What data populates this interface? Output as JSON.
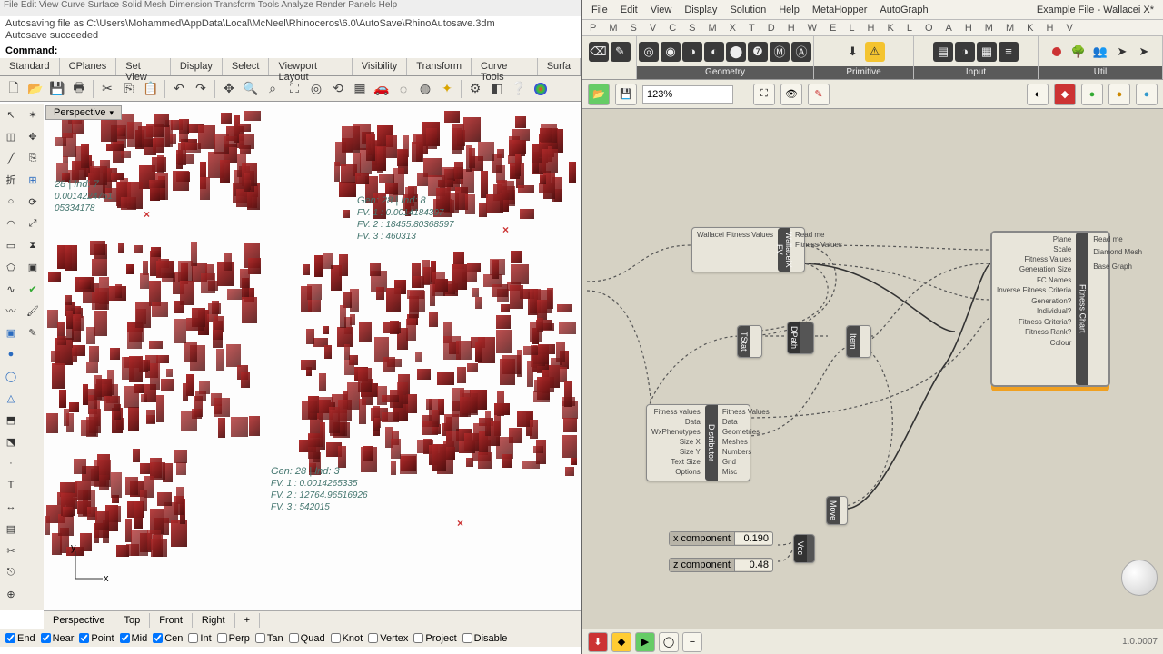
{
  "rhino": {
    "menubar": "File  Edit  View  Curve  Surface  Solid  Mesh  Dimension  Transform  Tools  Analyze  Render  Panels  Help",
    "autosave_line": "Autosaving file as C:\\Users\\Mohammed\\AppData\\Local\\McNeel\\Rhinoceros\\6.0\\AutoSave\\RhinoAutosave.3dm",
    "autosave_done": "Autosave succeeded",
    "command_label": "Command:",
    "tabs": [
      "Standard",
      "CPlanes",
      "Set View",
      "Display",
      "Select",
      "Viewport Layout",
      "Visibility",
      "Transform",
      "Curve Tools",
      "Surfa"
    ],
    "viewport_label": "Perspective",
    "view_tabs": [
      "Perspective",
      "Top",
      "Front",
      "Right",
      "+"
    ],
    "osnaps": [
      {
        "label": "End",
        "checked": true
      },
      {
        "label": "Near",
        "checked": true
      },
      {
        "label": "Point",
        "checked": true
      },
      {
        "label": "Mid",
        "checked": true
      },
      {
        "label": "Cen",
        "checked": true
      },
      {
        "label": "Int",
        "checked": false
      },
      {
        "label": "Perp",
        "checked": false
      },
      {
        "label": "Tan",
        "checked": false
      },
      {
        "label": "Quad",
        "checked": false
      },
      {
        "label": "Knot",
        "checked": false
      },
      {
        "label": "Vertex",
        "checked": false
      },
      {
        "label": "Project",
        "checked": false
      },
      {
        "label": "Disable",
        "checked": false
      }
    ],
    "anno1": {
      "l1": "28 | Ind: 7",
      "l2": "0.0014224751",
      "l3": "05334178"
    },
    "anno2": {
      "l1": "Gen: 28 | Ind: 8",
      "l2": "FV. 1 : 0.0014184397",
      "l3": "FV. 2 : 18455.80368597",
      "l4": "FV. 3 : 460313"
    },
    "anno3": {
      "l1": "Gen: 28 | Ind: 3",
      "l2": "FV. 1 : 0.0014265335",
      "l3": "FV. 2 : 12764.96516926",
      "l4": "FV. 3 : 542015"
    }
  },
  "gh": {
    "title": "Example File - Wallacei X*",
    "menu": [
      "File",
      "Edit",
      "View",
      "Display",
      "Solution",
      "Help",
      "MetaHopper",
      "AutoGraph"
    ],
    "letters": [
      "P",
      "M",
      "S",
      "V",
      "C",
      "S",
      "M",
      "X",
      "T",
      "D",
      "H",
      "W",
      "E",
      "L",
      "H",
      "K",
      "L",
      "O",
      "A",
      "H",
      "M",
      "M",
      "K",
      "H",
      "V"
    ],
    "ribbons": [
      "Geometry",
      "Primitive",
      "Input",
      "Util"
    ],
    "zoom": "123%",
    "version": "1.0.0007",
    "sliders": [
      {
        "label": "x component",
        "value": "0.190"
      },
      {
        "label": "z component",
        "value": "0.48"
      }
    ],
    "comp_wfv": {
      "spine": "WallaceiX FV",
      "in": "Wallacei Fitness Values",
      "out1": "Read me",
      "out2": "Fitness Values"
    },
    "comp_dist": {
      "spine": "Distributor",
      "ins": [
        "Fitness values",
        "Data",
        "WxPhenotypes",
        "Size X",
        "Size Y",
        "Text Size",
        "Options"
      ],
      "outs": [
        "Fitness Values",
        "Data",
        "Geometries",
        "Meshes",
        "Numbers",
        "Grid",
        "Misc"
      ]
    },
    "comp_tstat": {
      "spine": "TStat"
    },
    "comp_dpath": {
      "spine": "DPath"
    },
    "comp_item": {
      "spine": "Item"
    },
    "comp_move": {
      "spine": "Move"
    },
    "comp_vec": {
      "spine": "Vec"
    },
    "comp_fc": {
      "spine": "Fitness Chart",
      "ins": [
        "Plane",
        "Scale",
        "Fitness Values",
        "Generation Size",
        "",
        "FC Names",
        "Inverse Fitness Criteria",
        "",
        "Generation?",
        "Individual?",
        "",
        "Fitness Criteria?",
        "Fitness Rank?",
        "",
        "Colour"
      ],
      "outs": [
        "Read me",
        "",
        "",
        "",
        "Diamond Mesh",
        "",
        "",
        "",
        "",
        "",
        "Base Graph"
      ]
    }
  }
}
